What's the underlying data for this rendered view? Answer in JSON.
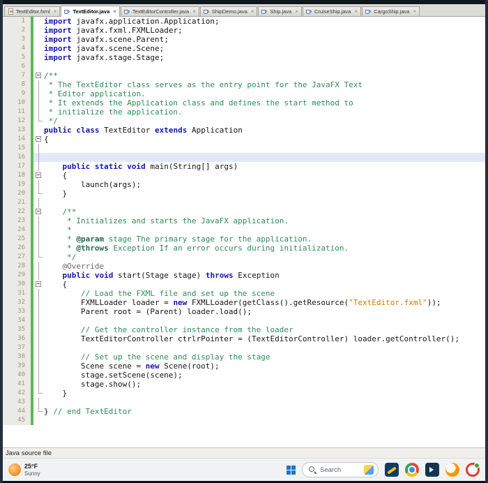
{
  "window": {
    "close_glyph": "×",
    "tabs": [
      {
        "label": "TextEditor.fxml",
        "type": "fxml",
        "active": false
      },
      {
        "label": "TextEditor.java",
        "type": "java",
        "active": true
      },
      {
        "label": "TextEditorController.java",
        "type": "java",
        "active": false
      },
      {
        "label": "ShipDemo.java",
        "type": "java",
        "active": false
      },
      {
        "label": "Ship.java",
        "type": "java",
        "active": false
      },
      {
        "label": "CruiseShip.java",
        "type": "java",
        "active": false
      },
      {
        "label": "CargoShip.java",
        "type": "java",
        "active": false
      }
    ]
  },
  "editor": {
    "current_line": 16,
    "line_count": 45,
    "colors": {
      "keyword": "#1515b0",
      "plain": "#151515",
      "comment": "#2e8b57",
      "javadoc_tag": "#1d6a52",
      "annotation": "#6b6b6b",
      "string": "#ce7b00",
      "vcs_added": "#5cb85c",
      "current_line_bg": "#e3e9f8",
      "gutter_bg": "#eceae5",
      "gutter_text": "#98958b"
    },
    "lines": [
      {
        "fold": "",
        "seg": [
          [
            "k",
            "import"
          ],
          [
            "p",
            " javafx.application.Application;"
          ]
        ]
      },
      {
        "fold": "",
        "seg": [
          [
            "k",
            "import"
          ],
          [
            "p",
            " javafx.fxml.FXMLLoader;"
          ]
        ]
      },
      {
        "fold": "",
        "seg": [
          [
            "k",
            "import"
          ],
          [
            "p",
            " javafx.scene.Parent;"
          ]
        ]
      },
      {
        "fold": "",
        "seg": [
          [
            "k",
            "import"
          ],
          [
            "p",
            " javafx.scene.Scene;"
          ]
        ]
      },
      {
        "fold": "",
        "seg": [
          [
            "k",
            "import"
          ],
          [
            "p",
            " javafx.stage.Stage;"
          ]
        ]
      },
      {
        "fold": "",
        "seg": []
      },
      {
        "fold": "box",
        "seg": [
          [
            "c",
            "/**"
          ]
        ]
      },
      {
        "fold": "line",
        "seg": [
          [
            "c",
            " * The TextEditor class serves as the entry point for the JavaFX Text"
          ]
        ]
      },
      {
        "fold": "line",
        "seg": [
          [
            "c",
            " * Editor application."
          ]
        ]
      },
      {
        "fold": "line",
        "seg": [
          [
            "c",
            " * It extends the Application class and defines the start method to"
          ]
        ]
      },
      {
        "fold": "line",
        "seg": [
          [
            "c",
            " * initialize the application."
          ]
        ]
      },
      {
        "fold": "end",
        "seg": [
          [
            "c",
            " */"
          ]
        ]
      },
      {
        "fold": "",
        "seg": [
          [
            "k",
            "public"
          ],
          [
            "p",
            " "
          ],
          [
            "k",
            "class"
          ],
          [
            "p",
            " TextEditor "
          ],
          [
            "k",
            "extends"
          ],
          [
            "p",
            " Application"
          ]
        ]
      },
      {
        "fold": "box",
        "seg": [
          [
            "p",
            "{"
          ]
        ]
      },
      {
        "fold": "line",
        "seg": []
      },
      {
        "fold": "line",
        "seg": []
      },
      {
        "fold": "line",
        "seg": [
          [
            "p",
            "    "
          ],
          [
            "k",
            "public"
          ],
          [
            "p",
            " "
          ],
          [
            "k",
            "static"
          ],
          [
            "p",
            " "
          ],
          [
            "k",
            "void"
          ],
          [
            "p",
            " main(String[] args)"
          ]
        ]
      },
      {
        "fold": "box",
        "seg": [
          [
            "p",
            "    {"
          ]
        ]
      },
      {
        "fold": "line",
        "seg": [
          [
            "p",
            "        launch(args);"
          ]
        ]
      },
      {
        "fold": "end",
        "seg": [
          [
            "p",
            "    }"
          ]
        ]
      },
      {
        "fold": "line",
        "seg": []
      },
      {
        "fold": "box",
        "seg": [
          [
            "c",
            "    /**"
          ]
        ]
      },
      {
        "fold": "line",
        "seg": [
          [
            "c",
            "     * Initializes and starts the JavaFX application."
          ]
        ]
      },
      {
        "fold": "line",
        "seg": [
          [
            "c",
            "     *"
          ]
        ]
      },
      {
        "fold": "line",
        "seg": [
          [
            "c",
            "     * "
          ],
          [
            "t",
            "@param"
          ],
          [
            "c",
            " stage The primary stage for the application."
          ]
        ]
      },
      {
        "fold": "line",
        "seg": [
          [
            "c",
            "     * "
          ],
          [
            "t",
            "@throws"
          ],
          [
            "c",
            " Exception If an error occurs during initialization."
          ]
        ]
      },
      {
        "fold": "end",
        "seg": [
          [
            "c",
            "     */"
          ]
        ]
      },
      {
        "fold": "line",
        "seg": [
          [
            "p",
            "    "
          ],
          [
            "a",
            "@Override"
          ]
        ]
      },
      {
        "fold": "line",
        "seg": [
          [
            "p",
            "    "
          ],
          [
            "k",
            "public"
          ],
          [
            "p",
            " "
          ],
          [
            "k",
            "void"
          ],
          [
            "p",
            " start(Stage stage) "
          ],
          [
            "k",
            "throws"
          ],
          [
            "p",
            " Exception"
          ]
        ]
      },
      {
        "fold": "box",
        "seg": [
          [
            "p",
            "    {"
          ]
        ]
      },
      {
        "fold": "line",
        "seg": [
          [
            "p",
            "        "
          ],
          [
            "c",
            "// Load the FXML file and set up the scene"
          ]
        ]
      },
      {
        "fold": "line",
        "seg": [
          [
            "p",
            "        FXMLLoader loader = "
          ],
          [
            "k",
            "new"
          ],
          [
            "p",
            " FXMLLoader(getClass().getResource("
          ],
          [
            "s",
            "\"TextEditor.fxml\""
          ],
          [
            "p",
            "));"
          ]
        ]
      },
      {
        "fold": "line",
        "seg": [
          [
            "p",
            "        Parent root = (Parent) loader.load();"
          ]
        ]
      },
      {
        "fold": "line",
        "seg": []
      },
      {
        "fold": "line",
        "seg": [
          [
            "p",
            "        "
          ],
          [
            "c",
            "// Get the controller instance from the loader"
          ]
        ]
      },
      {
        "fold": "line",
        "seg": [
          [
            "p",
            "        TextEditorController ctrlrPointer = (TextEditorController) loader.getController();"
          ]
        ]
      },
      {
        "fold": "line",
        "seg": []
      },
      {
        "fold": "line",
        "seg": [
          [
            "p",
            "        "
          ],
          [
            "c",
            "// Set up the scene and display the stage"
          ]
        ]
      },
      {
        "fold": "line",
        "seg": [
          [
            "p",
            "        Scene scene = "
          ],
          [
            "k",
            "new"
          ],
          [
            "p",
            " Scene(root);"
          ]
        ]
      },
      {
        "fold": "line",
        "seg": [
          [
            "p",
            "        stage.setScene(scene);"
          ]
        ]
      },
      {
        "fold": "line",
        "seg": [
          [
            "p",
            "        stage.show();"
          ]
        ]
      },
      {
        "fold": "end",
        "seg": [
          [
            "p",
            "    }"
          ]
        ]
      },
      {
        "fold": "line",
        "seg": []
      },
      {
        "fold": "end",
        "seg": [
          [
            "p",
            "} "
          ],
          [
            "c",
            "// end TextEditor"
          ]
        ]
      },
      {
        "fold": "",
        "seg": []
      }
    ]
  },
  "status_bar": {
    "text": "Java source file"
  },
  "taskbar": {
    "weather": {
      "temp": "25°F",
      "condition": "Sunny"
    },
    "search": {
      "placeholder": "Search"
    },
    "icons": [
      "windows-start-icon",
      "search-icon",
      "search-highlight-icon",
      "paint-icon",
      "chrome-icon",
      "terminal-icon",
      "firefox-icon",
      "opera-icon"
    ]
  }
}
